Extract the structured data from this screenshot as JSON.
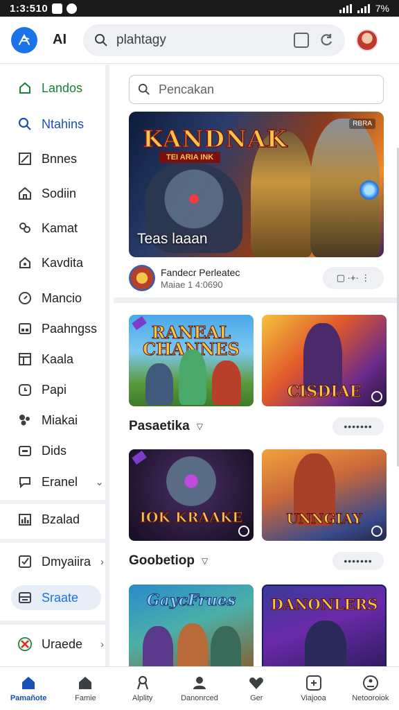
{
  "status_bar": {
    "time": "1:3:510",
    "battery": "7%"
  },
  "app_bar": {
    "title": "AI",
    "search_value": "plahtagy"
  },
  "sidebar": {
    "items": [
      {
        "label": "Landos",
        "icon": "home-outline-icon"
      },
      {
        "label": "Ntahins",
        "icon": "search-icon"
      },
      {
        "label": "Bnnes",
        "icon": "square-slash-icon"
      },
      {
        "label": "Sodiin",
        "icon": "house-icon"
      },
      {
        "label": "Kamat",
        "icon": "people-icon"
      },
      {
        "label": "Kavdita",
        "icon": "home-badge-icon"
      },
      {
        "label": "Mancio",
        "icon": "compass-icon"
      },
      {
        "label": "Paahngss",
        "icon": "grid-icon"
      },
      {
        "label": "Kaala",
        "icon": "layout-icon"
      },
      {
        "label": "Papi",
        "icon": "timer-icon"
      },
      {
        "label": "Miakai",
        "icon": "puzzle-icon"
      },
      {
        "label": "Dids",
        "icon": "calendar-icon"
      },
      {
        "label": "Eranel",
        "icon": "chat-icon"
      },
      {
        "label": "Bzalad",
        "icon": "bar-chart-icon"
      },
      {
        "label": "Dmyaiira",
        "icon": "checkbox-icon"
      },
      {
        "label": "Sraate",
        "icon": "tray-icon"
      },
      {
        "label": "Uraede",
        "icon": "xbox-icon"
      }
    ]
  },
  "content": {
    "search_placeholder": "Pencakan",
    "hero": {
      "wordmark": "KANDNAK",
      "wordmark_sub": "TEI ARIA INK",
      "badge": "RBRA",
      "caption": "Teas laaan"
    },
    "feature": {
      "title": "Fandecr Perleatec",
      "subtitle": "Maiae 1 4:0690",
      "actions": "▢ ·+· ⋮"
    },
    "tiles_row1": [
      {
        "title": "RANEAL CHANNES"
      },
      {
        "title": "CISDIAE"
      }
    ],
    "section1": {
      "title": "Pasaetika",
      "more": "•••••••"
    },
    "tiles_row2": [
      {
        "title": "IOK KRAAKE"
      },
      {
        "title": "UNNGIAY"
      }
    ],
    "section2": {
      "title": "Goobetiop",
      "more": "•••••••"
    },
    "tiles_row3": [
      {
        "title": "GaycFrues"
      },
      {
        "title": "DANONLERS"
      }
    ]
  },
  "bottom_nav": [
    {
      "label": "Pamañote",
      "icon": "home-icon"
    },
    {
      "label": "Famie",
      "icon": "house-icon"
    },
    {
      "label": "Alplity",
      "icon": "ribbon-icon"
    },
    {
      "label": "Danonrced",
      "icon": "person-icon"
    },
    {
      "label": "Ger",
      "icon": "heart-icon"
    },
    {
      "label": "Viajooa",
      "icon": "controller-icon"
    },
    {
      "label": "Netooroiok",
      "icon": "face-icon"
    }
  ],
  "colors": {
    "accent": "#1a73e8",
    "nav_active": "#1a4fb5",
    "green": "#188038",
    "surface": "#eef0f3"
  }
}
